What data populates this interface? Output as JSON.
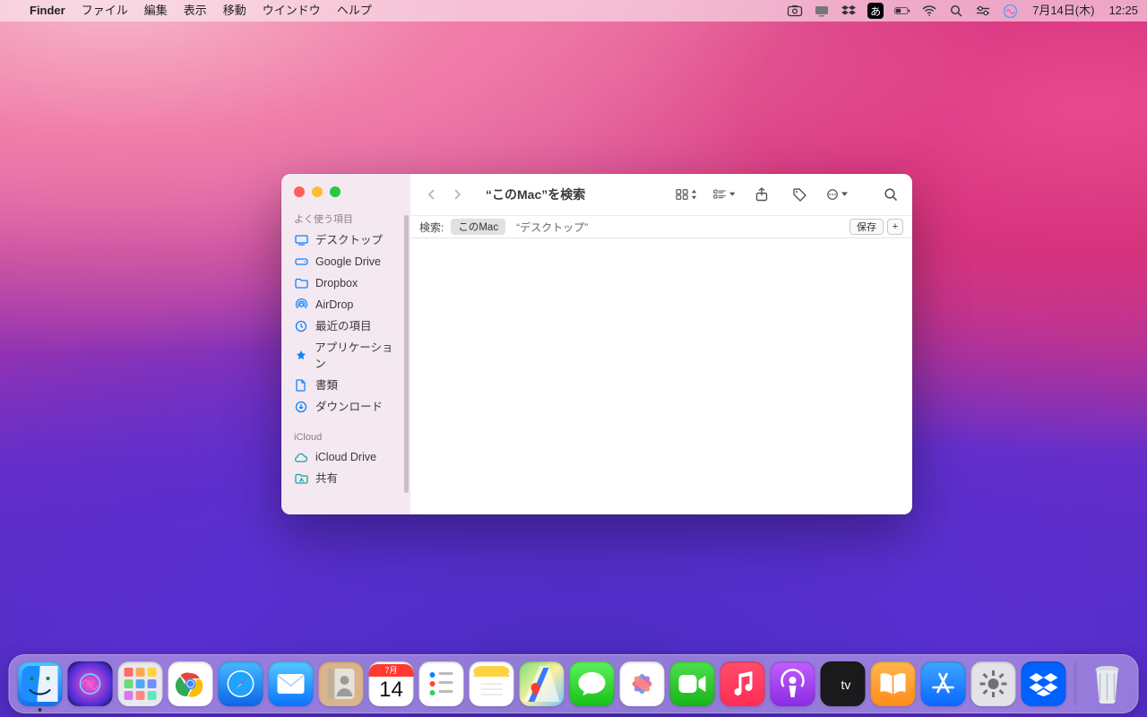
{
  "menubar": {
    "apple": "",
    "app_name": "Finder",
    "items": [
      "ファイル",
      "編集",
      "表示",
      "移動",
      "ウインドウ",
      "ヘルプ"
    ],
    "status": {
      "screenshot_icon": "screenshot",
      "display_icon": "display",
      "dropbox_icon": "dropbox",
      "ime_label": "あ",
      "battery_icon": "battery",
      "wifi_icon": "wifi",
      "spotlight_icon": "search",
      "control_center_icon": "control-center",
      "siri_icon": "siri",
      "date": "7月14日(木)",
      "time": "12:25"
    }
  },
  "finder": {
    "sidebar": {
      "section_favorites": "よく使う項目",
      "items": [
        {
          "icon": "desktop",
          "label": "デスクトップ"
        },
        {
          "icon": "gdrive",
          "label": "Google Drive"
        },
        {
          "icon": "folder",
          "label": "Dropbox"
        },
        {
          "icon": "airdrop",
          "label": "AirDrop"
        },
        {
          "icon": "clock",
          "label": "最近の項目"
        },
        {
          "icon": "apps",
          "label": "アプリケーション"
        },
        {
          "icon": "doc",
          "label": "書類"
        },
        {
          "icon": "download",
          "label": "ダウンロード"
        }
      ],
      "section_icloud": "iCloud",
      "icloud_items": [
        {
          "icon": "cloud",
          "label": "iCloud Drive"
        },
        {
          "icon": "shared",
          "label": "共有"
        }
      ]
    },
    "toolbar": {
      "title": "“このMac”を検索"
    },
    "searchbar": {
      "label": "検索:",
      "scope_active": "このMac",
      "scope_other": "“デスクトップ”",
      "save": "保存",
      "add": "+"
    }
  },
  "dock": {
    "calendar_month": "7月",
    "calendar_day": "14",
    "apps": [
      "finder",
      "siri",
      "launchpad",
      "chrome",
      "safari",
      "mail",
      "contacts",
      "calendar",
      "reminders",
      "notes",
      "maps",
      "messages",
      "photos",
      "facetime",
      "music",
      "podcasts",
      "tv",
      "books",
      "appstore",
      "settings",
      "dropbox"
    ],
    "trash": "trash"
  }
}
